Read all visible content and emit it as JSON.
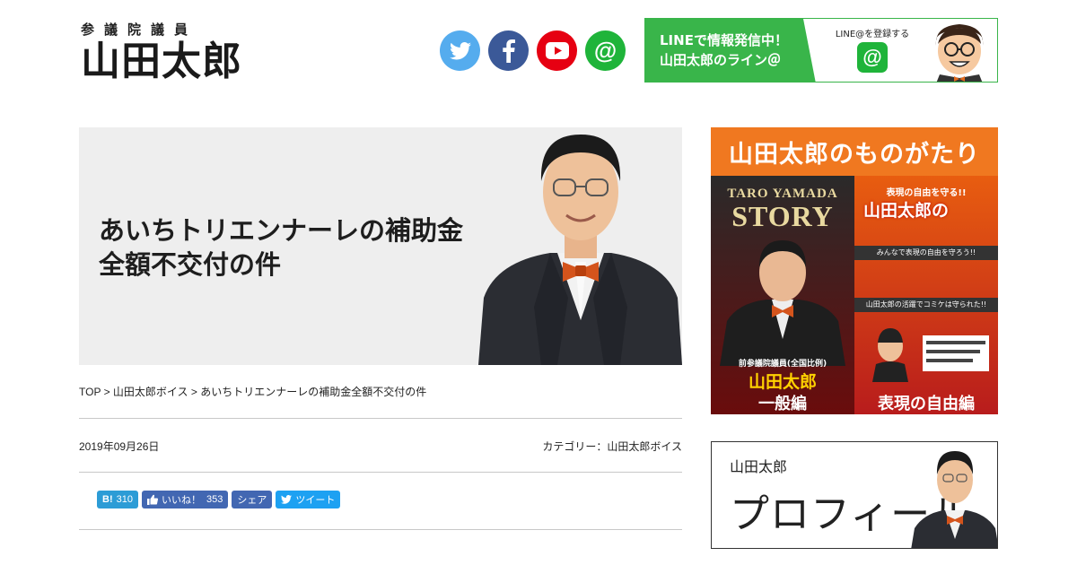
{
  "header": {
    "logo_sub": "参議院議員",
    "logo_main": "山田太郎",
    "social": [
      {
        "icon": "twitter-icon",
        "color": "#55acee"
      },
      {
        "icon": "facebook-icon",
        "color": "#3b5998"
      },
      {
        "icon": "youtube-icon",
        "color": "#e60012"
      },
      {
        "icon": "line-at-icon",
        "color": "#1fb43a"
      }
    ],
    "line_banner": {
      "line1": "LINEで情報発信中！",
      "line2": "山田太郎のライン＠",
      "register": "LINE@を登録する",
      "at": "@"
    }
  },
  "hero": {
    "title_line1": "あいちトリエンナーレの補助金",
    "title_line2": "全額不交付の件"
  },
  "breadcrumb": {
    "top": "TOP",
    "sep": " > ",
    "section": "山田太郎ボイス",
    "current": "あいちトリエンナーレの補助金全額不交付の件"
  },
  "meta": {
    "date": "2019年09月26日",
    "category_label": "カテゴリー：",
    "category": "山田太郎ボイス"
  },
  "share": {
    "hatena_label": "B!",
    "hatena_count": "310",
    "like_label": "いいね！",
    "like_count": "353",
    "share_label": "シェア",
    "tweet_label": "ツイート"
  },
  "sidebar": {
    "story": {
      "header": "山田太郎のものがたり",
      "left_eng1": "TARO YAMADA",
      "left_eng2": "STORY",
      "left_title_small": "前参議院議員(全国比例)",
      "left_title_name": "山田太郎",
      "left_bottom": "一般編",
      "right_top": "表現の自由を守る!!",
      "right_name": "山田太郎の",
      "right_band1": "みんなで表現の自由を守ろう!!",
      "right_band2": "山田太郎の活躍でコミケは守られた!!",
      "right_bottom": "表現の自由編"
    },
    "profile": {
      "small": "山田太郎",
      "big": "プロフィール"
    }
  }
}
